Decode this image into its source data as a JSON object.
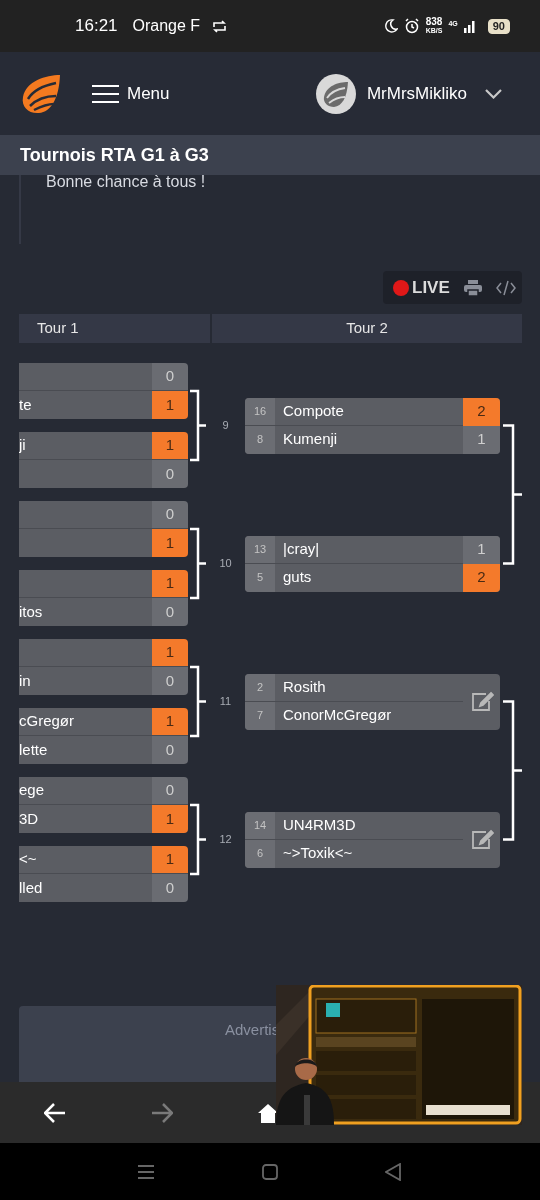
{
  "status_bar": {
    "time": "16:21",
    "carrier": "Orange F",
    "speed": "838",
    "speed_unit": "KB/S",
    "network": "4G",
    "battery": "90"
  },
  "header": {
    "menu_label": "Menu",
    "username": "MrMrsMikliko"
  },
  "page_title": "Tournois RTA G1 à G3",
  "intro": "Bonne chance à tous !",
  "toolbar": {
    "live_label": "LIVE"
  },
  "rounds": [
    "Tour 1",
    "Tour 2"
  ],
  "groups": [
    {
      "pairs": [
        {
          "number": "9",
          "boxes": [
            [
              {
                "score": "0",
                "winner": false
              },
              {
                "name": "te",
                "score": "1",
                "winner": true
              }
            ],
            [
              {
                "name": "ji",
                "score": "1",
                "winner": true
              },
              {
                "score": "0",
                "winner": false
              }
            ]
          ],
          "next": {
            "kind": "result",
            "players": [
              {
                "seed": "16",
                "name": "Compote",
                "score": "2",
                "winner": true
              },
              {
                "seed": "8",
                "name": "Kumenji",
                "score": "1",
                "winner": false
              }
            ]
          }
        },
        {
          "number": "10",
          "boxes": [
            [
              {
                "score": "0",
                "winner": false
              },
              {
                "score": "1",
                "winner": true
              }
            ],
            [
              {
                "score": "1",
                "winner": true
              },
              {
                "name": "itos",
                "score": "0",
                "winner": false
              }
            ]
          ],
          "next": {
            "kind": "result",
            "players": [
              {
                "seed": "13",
                "name": "|cray|",
                "score": "1",
                "winner": false
              },
              {
                "seed": "5",
                "name": "guts",
                "score": "2",
                "winner": true
              }
            ]
          }
        }
      ]
    },
    {
      "pairs": [
        {
          "number": "11",
          "boxes": [
            [
              {
                "score": "1",
                "winner": true
              },
              {
                "name": "in",
                "score": "0",
                "winner": false
              }
            ],
            [
              {
                "name": "cGregør",
                "score": "1",
                "winner": true
              },
              {
                "name": "lette",
                "score": "0",
                "winner": false
              }
            ]
          ],
          "next": {
            "kind": "pending",
            "players": [
              {
                "seed": "2",
                "name": "Rosith"
              },
              {
                "seed": "7",
                "name": "ConorMcGregør"
              }
            ]
          }
        },
        {
          "number": "12",
          "boxes": [
            [
              {
                "name": "ege",
                "score": "0",
                "winner": false
              },
              {
                "name": "3D",
                "score": "1",
                "winner": true
              }
            ],
            [
              {
                "name": "<~",
                "score": "1",
                "winner": true
              },
              {
                "name": "lled",
                "score": "0",
                "winner": false
              }
            ]
          ],
          "next": {
            "kind": "pending",
            "players": [
              {
                "seed": "14",
                "name": "UN4RM3D"
              },
              {
                "seed": "6",
                "name": "~>Toxik<~"
              }
            ]
          }
        }
      ]
    }
  ],
  "ad": {
    "label": "Advertis"
  }
}
